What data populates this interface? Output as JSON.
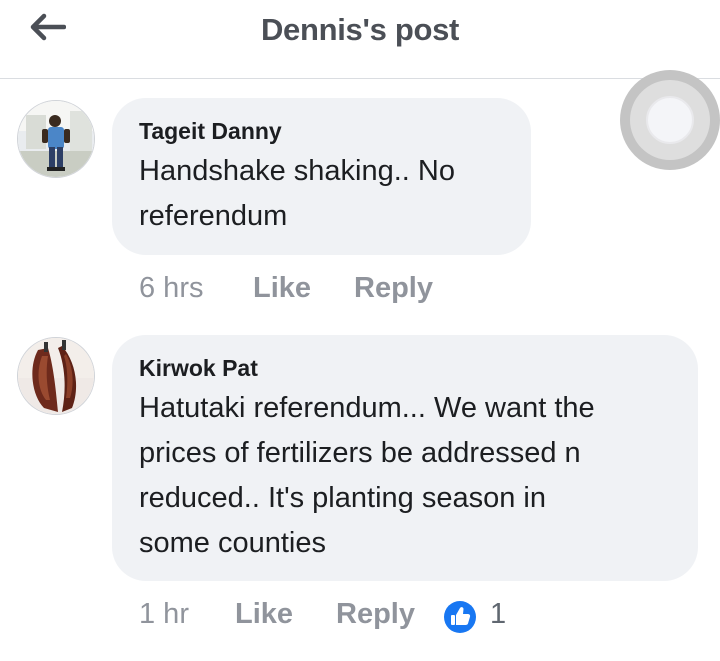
{
  "header": {
    "title": "Dennis's post",
    "back_icon": "arrow-left-icon"
  },
  "comments": [
    {
      "author": "Tageit Danny",
      "text_lines": [
        "Handshake shaking.. No",
        "referendum"
      ],
      "time": "6 hrs",
      "like_label": "Like",
      "reply_label": "Reply"
    },
    {
      "author": "Kirwok Pat",
      "text_lines": [
        "Hatutaki referendum... We want the",
        "prices of fertilizers be addressed n",
        "reduced.. It's planting season in",
        "some counties"
      ],
      "time": "1 hr",
      "like_label": "Like",
      "reply_label": "Reply",
      "reaction_icon": "thumbs-up-icon",
      "reaction_count": "1"
    }
  ],
  "floating_button": {
    "icon": "assistive-touch-icon"
  },
  "colors": {
    "title": "#4b4f56",
    "bubble": "#f0f2f5",
    "meta": "#90949c",
    "like_blue": "#1877f2",
    "divider": "#dadde1"
  }
}
